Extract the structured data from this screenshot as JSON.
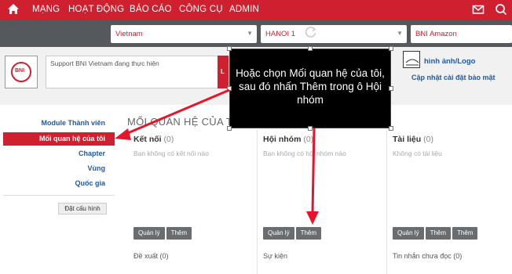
{
  "topnav": {
    "items": [
      "MẠNG",
      "HOẠT ĐỘNG",
      "BÁO CÁO",
      "CÔNG CỤ",
      "ADMIN"
    ],
    "icons": [
      "home-icon",
      "mail-icon",
      "search-icon"
    ]
  },
  "selectors": {
    "country": "Vietnam",
    "region": "HANOI 1",
    "chapter": "BNI Amazon"
  },
  "profile": {
    "logo_text": "BNI",
    "status_text": "Support BNI Vietnam đang thực hiện",
    "status_button": "L",
    "image_link": "hình ảnh/Logo",
    "security_link": "Cập nhật cài đặt bảo mật"
  },
  "sidebar": {
    "items": [
      "Module Thành viên",
      "Mối quan hệ của tôi",
      "Chapter",
      "Vùng",
      "Quốc gia"
    ],
    "config_button": "Đặt cấu hình"
  },
  "main": {
    "title": "MỐI QUAN HỆ CỦA T",
    "columns": [
      {
        "title": "Kết nối",
        "count": "(0)",
        "empty": "Bạn không có kết nối nào",
        "buttons": [
          "Quản lý",
          "Thêm"
        ],
        "bottom": "Đề xuất (0)"
      },
      {
        "title": "Hội nhóm",
        "count": "(0)",
        "empty": "Bạn không có hội nhóm nào",
        "buttons": [
          "Quản lý",
          "Thêm"
        ],
        "bottom": "Sự kiện"
      },
      {
        "title": "Tài liệu",
        "count": "(0)",
        "empty": "Không có tài liệu",
        "buttons": [
          "Quản lý",
          "Thêm",
          "Thêm"
        ],
        "bottom": "Tin nhắn chưa đọc (0)"
      }
    ]
  },
  "callout": {
    "text": "Hoặc chọn Mối quan hệ của tôi, sau đó nhấn Thêm trong ô Hội nhóm"
  },
  "colors": {
    "brand_red": "#cf2030",
    "selector_bar": "#55585c",
    "link_blue": "#1e5aa8",
    "button_gray": "#6a6d70"
  }
}
